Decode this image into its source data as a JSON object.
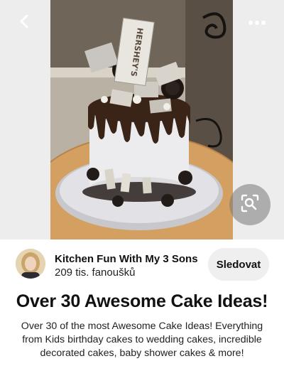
{
  "top_bar": {
    "back_icon": "chevron-left-icon",
    "more_icon": "ellipsis-icon"
  },
  "media": {
    "lens_icon": "visual-search-icon"
  },
  "author": {
    "name": "Kitchen Fun With My 3 Sons",
    "followers": "209 tis. fanoušků",
    "follow_label": "Sledovat"
  },
  "pin": {
    "title": "Over 30 Awesome Cake Ideas!",
    "description": "Over 30 of the most Awesome Cake Ideas! Everything from Kids birthday cakes to wedding cakes, incredible decorated cakes, baby shower cakes & more!"
  },
  "photo_text": {
    "candy_bar": "HERSHEY'S"
  },
  "colors": {
    "follow_button_bg": "#efefef",
    "lens_button_bg": "#8a8a8a",
    "text_primary": "#111111"
  }
}
